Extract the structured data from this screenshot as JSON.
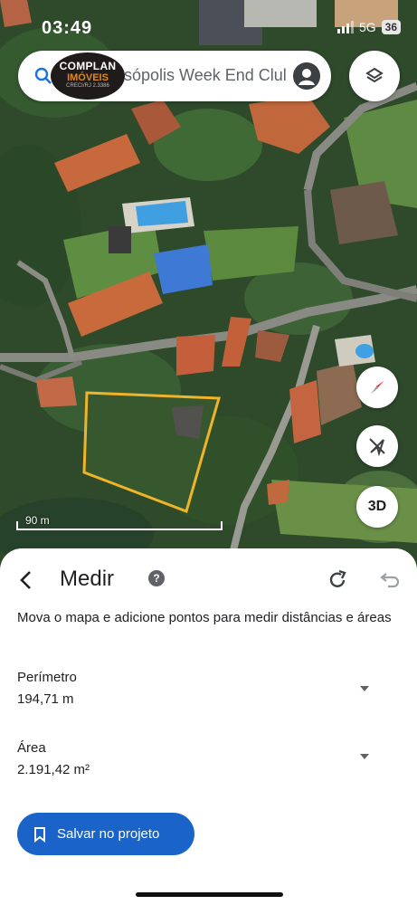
{
  "status_bar": {
    "time": "03:49",
    "network": "5G",
    "battery": "36"
  },
  "search": {
    "query": "sópolis Week End Clul"
  },
  "logo": {
    "line1": "COMPLAN",
    "line2": "IMÓVEIS",
    "line3": "CRECI/RJ 2.3386"
  },
  "map": {
    "scale_label": "90 m",
    "three_d_label": "3D",
    "polygon_color": "#f0b429"
  },
  "icons": {
    "search": "search-icon",
    "account": "account-icon",
    "layers": "layers-icon",
    "compass": "compass-icon",
    "north_up": "north-up-icon",
    "back": "back-arrow-icon",
    "help": "help-icon",
    "redo": "redo-icon",
    "undo": "undo-icon",
    "bookmark": "bookmark-icon"
  },
  "panel": {
    "title": "Medir",
    "help_glyph": "?",
    "description": "Mova o mapa e adicione pontos para medir distâncias e áreas",
    "perimeter": {
      "label": "Perímetro",
      "value": "194,71 m"
    },
    "area": {
      "label": "Área",
      "value": "2.191,42 m²"
    },
    "save_button": "Salvar no projeto"
  },
  "colors": {
    "accent": "#1a63c8",
    "compass_red": "#e53935"
  }
}
